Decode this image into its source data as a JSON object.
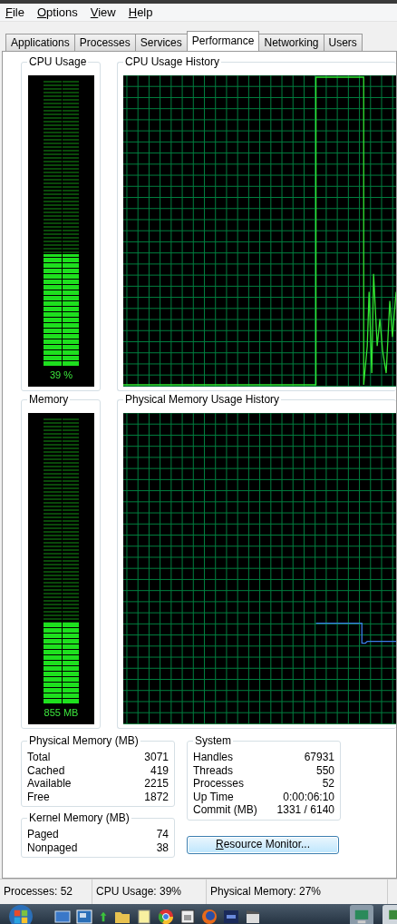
{
  "menu": [
    {
      "label": "File"
    },
    {
      "label": "Options"
    },
    {
      "label": "View"
    },
    {
      "label": "Help"
    }
  ],
  "tabs": [
    {
      "label": "Applications",
      "selected": false
    },
    {
      "label": "Processes",
      "selected": false
    },
    {
      "label": "Services",
      "selected": false
    },
    {
      "label": "Performance",
      "selected": true
    },
    {
      "label": "Networking",
      "selected": false
    },
    {
      "label": "Users",
      "selected": false
    }
  ],
  "cpu_usage": {
    "title": "CPU Usage",
    "reading": "39 %",
    "level": 0.39
  },
  "cpu_usage_history": {
    "title": "CPU Usage History"
  },
  "memory": {
    "title": "Memory",
    "reading": "855 MB",
    "level": 0.28
  },
  "physical_memory_usage_history": {
    "title": "Physical Memory Usage History"
  },
  "physical_memory": {
    "title": "Physical Memory (MB)",
    "rows": [
      {
        "label": "Total",
        "value": "3071"
      },
      {
        "label": "Cached",
        "value": "419"
      },
      {
        "label": "Available",
        "value": "2215"
      },
      {
        "label": "Free",
        "value": "1872"
      }
    ]
  },
  "kernel_memory": {
    "title": "Kernel Memory (MB)",
    "rows": [
      {
        "label": "Paged",
        "value": "74"
      },
      {
        "label": "Nonpaged",
        "value": "38"
      }
    ]
  },
  "system": {
    "title": "System",
    "rows": [
      {
        "label": "Handles",
        "value": "67931"
      },
      {
        "label": "Threads",
        "value": "550"
      },
      {
        "label": "Processes",
        "value": "52"
      },
      {
        "label": "Up Time",
        "value": "0:00:06:10"
      },
      {
        "label": "Commit (MB)",
        "value": "1331 / 6140"
      }
    ]
  },
  "resource_monitor_button": {
    "label": "Resource Monitor..."
  },
  "status_bar": [
    "Processes: 52",
    "CPU Usage: 39%",
    "Physical Memory: 27%"
  ]
}
